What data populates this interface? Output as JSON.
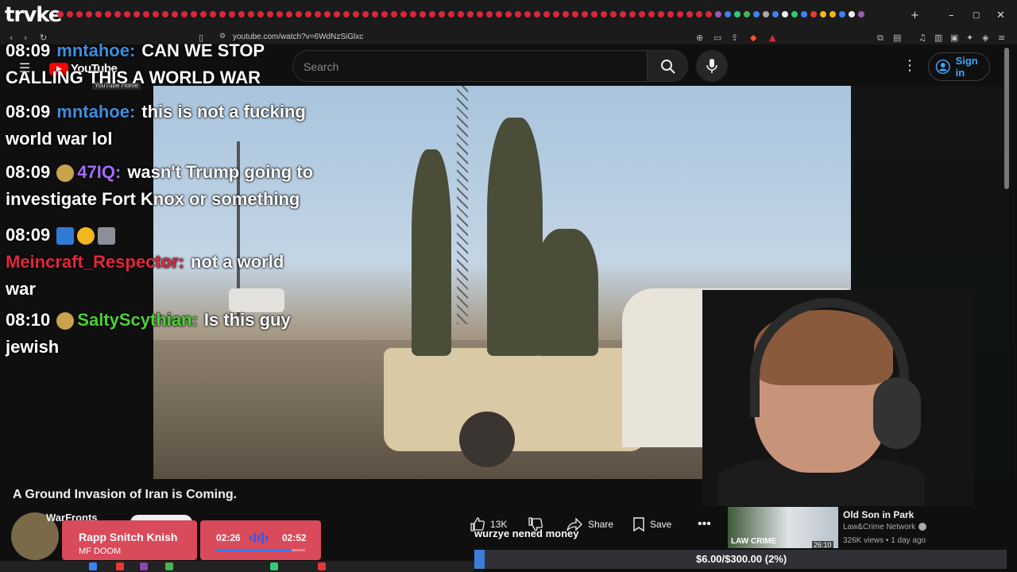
{
  "overlay": {
    "stream_logo": "trvke"
  },
  "browser": {
    "url": "youtube.com/watch?v=6WdNzSiGlxc",
    "window_controls": [
      "–",
      "▢",
      "✕"
    ],
    "new_tab": "+"
  },
  "youtube": {
    "logo_text": "YouTube",
    "logo_tooltip": "YouTube Home",
    "search_placeholder": "Search",
    "sign_in_label": "Sign in",
    "video_title": "A Ground Invasion of Iran is Coming.",
    "channel_name": "WarFronts",
    "actions": {
      "like_count": "13K",
      "share_label": "Share",
      "save_label": "Save"
    },
    "recommended": {
      "title": "Old Son in Park",
      "channel": "Law&Crime Network",
      "meta": "326K views • 1 day ago",
      "duration": "26:10",
      "thumb_text": "LAW CRIME"
    }
  },
  "chat": [
    {
      "time": "08:09",
      "user": "mntahoe:",
      "user_color": "#3e8ede",
      "text": "CAN WE STOP CALLING THIS A WORLD WAR"
    },
    {
      "time": "08:09",
      "user": "mntahoe:",
      "user_color": "#3e8ede",
      "text": "this is not a fucking world war lol"
    },
    {
      "time": "08:09",
      "user": "47IQ:",
      "user_color": "#a66bff",
      "text": "wasn't Trump going to investigate Fort Knox or something"
    },
    {
      "time": "08:09",
      "user": "Meincraft_Respector:",
      "user_color": "#e0283b",
      "text": "not a world war"
    },
    {
      "time": "08:10",
      "user": "SaltyScythian:",
      "user_color": "#4cd137",
      "text": "Is this guy jewish"
    }
  ],
  "music": {
    "title": "Rapp Snitch Knish",
    "artist": "MF DOOM",
    "current_time": "02:26",
    "total_time": "02:52",
    "progress": 0.85
  },
  "caption": "wurzye nened money",
  "goal": {
    "text": "$6.00/$300.00 (2%)",
    "progress": 0.02
  },
  "colors": {
    "accent_blue": "#3ea6ff",
    "music_card": "#d94a5a",
    "goal_fill": "#3d7dd8"
  }
}
